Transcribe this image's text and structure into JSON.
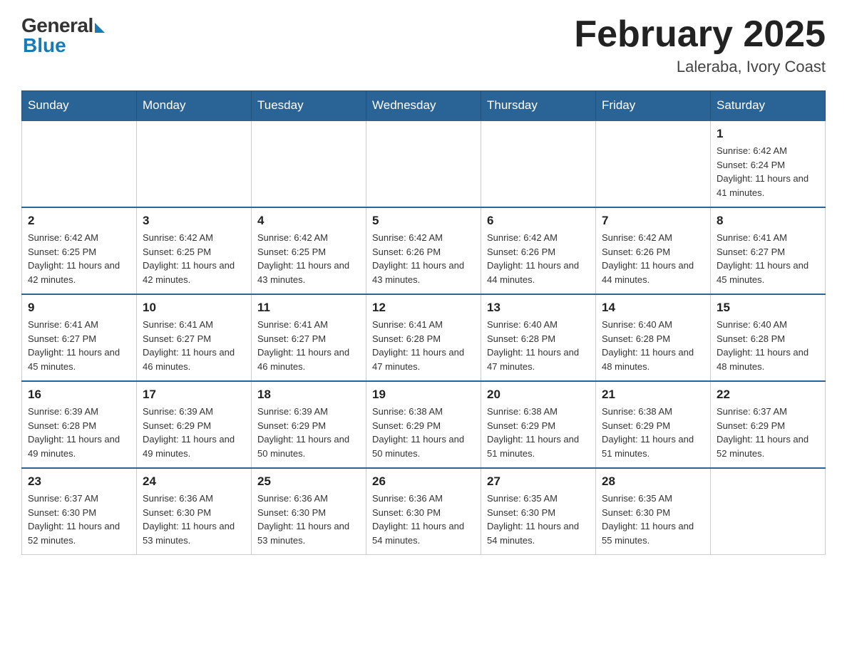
{
  "logo": {
    "general": "General",
    "blue": "Blue"
  },
  "title": "February 2025",
  "location": "Laleraba, Ivory Coast",
  "days_of_week": [
    "Sunday",
    "Monday",
    "Tuesday",
    "Wednesday",
    "Thursday",
    "Friday",
    "Saturday"
  ],
  "weeks": [
    [
      {
        "day": "",
        "info": ""
      },
      {
        "day": "",
        "info": ""
      },
      {
        "day": "",
        "info": ""
      },
      {
        "day": "",
        "info": ""
      },
      {
        "day": "",
        "info": ""
      },
      {
        "day": "",
        "info": ""
      },
      {
        "day": "1",
        "info": "Sunrise: 6:42 AM\nSunset: 6:24 PM\nDaylight: 11 hours and 41 minutes."
      }
    ],
    [
      {
        "day": "2",
        "info": "Sunrise: 6:42 AM\nSunset: 6:25 PM\nDaylight: 11 hours and 42 minutes."
      },
      {
        "day": "3",
        "info": "Sunrise: 6:42 AM\nSunset: 6:25 PM\nDaylight: 11 hours and 42 minutes."
      },
      {
        "day": "4",
        "info": "Sunrise: 6:42 AM\nSunset: 6:25 PM\nDaylight: 11 hours and 43 minutes."
      },
      {
        "day": "5",
        "info": "Sunrise: 6:42 AM\nSunset: 6:26 PM\nDaylight: 11 hours and 43 minutes."
      },
      {
        "day": "6",
        "info": "Sunrise: 6:42 AM\nSunset: 6:26 PM\nDaylight: 11 hours and 44 minutes."
      },
      {
        "day": "7",
        "info": "Sunrise: 6:42 AM\nSunset: 6:26 PM\nDaylight: 11 hours and 44 minutes."
      },
      {
        "day": "8",
        "info": "Sunrise: 6:41 AM\nSunset: 6:27 PM\nDaylight: 11 hours and 45 minutes."
      }
    ],
    [
      {
        "day": "9",
        "info": "Sunrise: 6:41 AM\nSunset: 6:27 PM\nDaylight: 11 hours and 45 minutes."
      },
      {
        "day": "10",
        "info": "Sunrise: 6:41 AM\nSunset: 6:27 PM\nDaylight: 11 hours and 46 minutes."
      },
      {
        "day": "11",
        "info": "Sunrise: 6:41 AM\nSunset: 6:27 PM\nDaylight: 11 hours and 46 minutes."
      },
      {
        "day": "12",
        "info": "Sunrise: 6:41 AM\nSunset: 6:28 PM\nDaylight: 11 hours and 47 minutes."
      },
      {
        "day": "13",
        "info": "Sunrise: 6:40 AM\nSunset: 6:28 PM\nDaylight: 11 hours and 47 minutes."
      },
      {
        "day": "14",
        "info": "Sunrise: 6:40 AM\nSunset: 6:28 PM\nDaylight: 11 hours and 48 minutes."
      },
      {
        "day": "15",
        "info": "Sunrise: 6:40 AM\nSunset: 6:28 PM\nDaylight: 11 hours and 48 minutes."
      }
    ],
    [
      {
        "day": "16",
        "info": "Sunrise: 6:39 AM\nSunset: 6:28 PM\nDaylight: 11 hours and 49 minutes."
      },
      {
        "day": "17",
        "info": "Sunrise: 6:39 AM\nSunset: 6:29 PM\nDaylight: 11 hours and 49 minutes."
      },
      {
        "day": "18",
        "info": "Sunrise: 6:39 AM\nSunset: 6:29 PM\nDaylight: 11 hours and 50 minutes."
      },
      {
        "day": "19",
        "info": "Sunrise: 6:38 AM\nSunset: 6:29 PM\nDaylight: 11 hours and 50 minutes."
      },
      {
        "day": "20",
        "info": "Sunrise: 6:38 AM\nSunset: 6:29 PM\nDaylight: 11 hours and 51 minutes."
      },
      {
        "day": "21",
        "info": "Sunrise: 6:38 AM\nSunset: 6:29 PM\nDaylight: 11 hours and 51 minutes."
      },
      {
        "day": "22",
        "info": "Sunrise: 6:37 AM\nSunset: 6:29 PM\nDaylight: 11 hours and 52 minutes."
      }
    ],
    [
      {
        "day": "23",
        "info": "Sunrise: 6:37 AM\nSunset: 6:30 PM\nDaylight: 11 hours and 52 minutes."
      },
      {
        "day": "24",
        "info": "Sunrise: 6:36 AM\nSunset: 6:30 PM\nDaylight: 11 hours and 53 minutes."
      },
      {
        "day": "25",
        "info": "Sunrise: 6:36 AM\nSunset: 6:30 PM\nDaylight: 11 hours and 53 minutes."
      },
      {
        "day": "26",
        "info": "Sunrise: 6:36 AM\nSunset: 6:30 PM\nDaylight: 11 hours and 54 minutes."
      },
      {
        "day": "27",
        "info": "Sunrise: 6:35 AM\nSunset: 6:30 PM\nDaylight: 11 hours and 54 minutes."
      },
      {
        "day": "28",
        "info": "Sunrise: 6:35 AM\nSunset: 6:30 PM\nDaylight: 11 hours and 55 minutes."
      },
      {
        "day": "",
        "info": ""
      }
    ]
  ]
}
